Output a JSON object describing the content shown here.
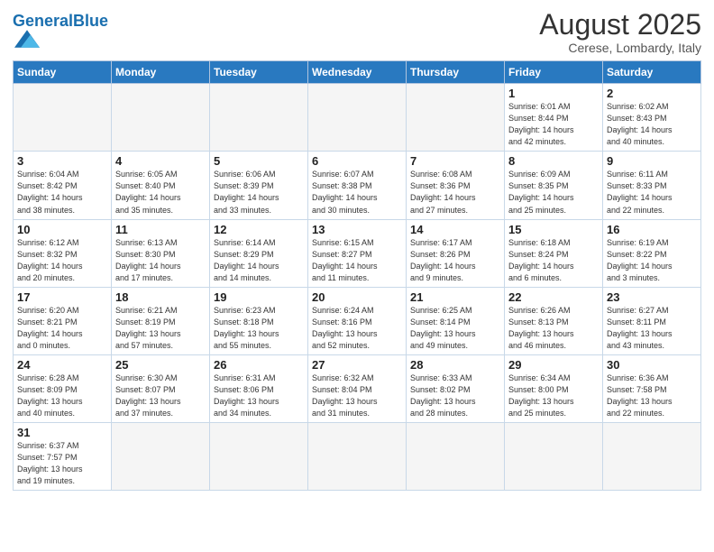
{
  "header": {
    "logo_general": "General",
    "logo_blue": "Blue",
    "month_year": "August 2025",
    "location": "Cerese, Lombardy, Italy"
  },
  "weekdays": [
    "Sunday",
    "Monday",
    "Tuesday",
    "Wednesday",
    "Thursday",
    "Friday",
    "Saturday"
  ],
  "weeks": [
    [
      {
        "day": "",
        "info": ""
      },
      {
        "day": "",
        "info": ""
      },
      {
        "day": "",
        "info": ""
      },
      {
        "day": "",
        "info": ""
      },
      {
        "day": "",
        "info": ""
      },
      {
        "day": "1",
        "info": "Sunrise: 6:01 AM\nSunset: 8:44 PM\nDaylight: 14 hours\nand 42 minutes."
      },
      {
        "day": "2",
        "info": "Sunrise: 6:02 AM\nSunset: 8:43 PM\nDaylight: 14 hours\nand 40 minutes."
      }
    ],
    [
      {
        "day": "3",
        "info": "Sunrise: 6:04 AM\nSunset: 8:42 PM\nDaylight: 14 hours\nand 38 minutes."
      },
      {
        "day": "4",
        "info": "Sunrise: 6:05 AM\nSunset: 8:40 PM\nDaylight: 14 hours\nand 35 minutes."
      },
      {
        "day": "5",
        "info": "Sunrise: 6:06 AM\nSunset: 8:39 PM\nDaylight: 14 hours\nand 33 minutes."
      },
      {
        "day": "6",
        "info": "Sunrise: 6:07 AM\nSunset: 8:38 PM\nDaylight: 14 hours\nand 30 minutes."
      },
      {
        "day": "7",
        "info": "Sunrise: 6:08 AM\nSunset: 8:36 PM\nDaylight: 14 hours\nand 27 minutes."
      },
      {
        "day": "8",
        "info": "Sunrise: 6:09 AM\nSunset: 8:35 PM\nDaylight: 14 hours\nand 25 minutes."
      },
      {
        "day": "9",
        "info": "Sunrise: 6:11 AM\nSunset: 8:33 PM\nDaylight: 14 hours\nand 22 minutes."
      }
    ],
    [
      {
        "day": "10",
        "info": "Sunrise: 6:12 AM\nSunset: 8:32 PM\nDaylight: 14 hours\nand 20 minutes."
      },
      {
        "day": "11",
        "info": "Sunrise: 6:13 AM\nSunset: 8:30 PM\nDaylight: 14 hours\nand 17 minutes."
      },
      {
        "day": "12",
        "info": "Sunrise: 6:14 AM\nSunset: 8:29 PM\nDaylight: 14 hours\nand 14 minutes."
      },
      {
        "day": "13",
        "info": "Sunrise: 6:15 AM\nSunset: 8:27 PM\nDaylight: 14 hours\nand 11 minutes."
      },
      {
        "day": "14",
        "info": "Sunrise: 6:17 AM\nSunset: 8:26 PM\nDaylight: 14 hours\nand 9 minutes."
      },
      {
        "day": "15",
        "info": "Sunrise: 6:18 AM\nSunset: 8:24 PM\nDaylight: 14 hours\nand 6 minutes."
      },
      {
        "day": "16",
        "info": "Sunrise: 6:19 AM\nSunset: 8:22 PM\nDaylight: 14 hours\nand 3 minutes."
      }
    ],
    [
      {
        "day": "17",
        "info": "Sunrise: 6:20 AM\nSunset: 8:21 PM\nDaylight: 14 hours\nand 0 minutes."
      },
      {
        "day": "18",
        "info": "Sunrise: 6:21 AM\nSunset: 8:19 PM\nDaylight: 13 hours\nand 57 minutes."
      },
      {
        "day": "19",
        "info": "Sunrise: 6:23 AM\nSunset: 8:18 PM\nDaylight: 13 hours\nand 55 minutes."
      },
      {
        "day": "20",
        "info": "Sunrise: 6:24 AM\nSunset: 8:16 PM\nDaylight: 13 hours\nand 52 minutes."
      },
      {
        "day": "21",
        "info": "Sunrise: 6:25 AM\nSunset: 8:14 PM\nDaylight: 13 hours\nand 49 minutes."
      },
      {
        "day": "22",
        "info": "Sunrise: 6:26 AM\nSunset: 8:13 PM\nDaylight: 13 hours\nand 46 minutes."
      },
      {
        "day": "23",
        "info": "Sunrise: 6:27 AM\nSunset: 8:11 PM\nDaylight: 13 hours\nand 43 minutes."
      }
    ],
    [
      {
        "day": "24",
        "info": "Sunrise: 6:28 AM\nSunset: 8:09 PM\nDaylight: 13 hours\nand 40 minutes."
      },
      {
        "day": "25",
        "info": "Sunrise: 6:30 AM\nSunset: 8:07 PM\nDaylight: 13 hours\nand 37 minutes."
      },
      {
        "day": "26",
        "info": "Sunrise: 6:31 AM\nSunset: 8:06 PM\nDaylight: 13 hours\nand 34 minutes."
      },
      {
        "day": "27",
        "info": "Sunrise: 6:32 AM\nSunset: 8:04 PM\nDaylight: 13 hours\nand 31 minutes."
      },
      {
        "day": "28",
        "info": "Sunrise: 6:33 AM\nSunset: 8:02 PM\nDaylight: 13 hours\nand 28 minutes."
      },
      {
        "day": "29",
        "info": "Sunrise: 6:34 AM\nSunset: 8:00 PM\nDaylight: 13 hours\nand 25 minutes."
      },
      {
        "day": "30",
        "info": "Sunrise: 6:36 AM\nSunset: 7:58 PM\nDaylight: 13 hours\nand 22 minutes."
      }
    ],
    [
      {
        "day": "31",
        "info": "Sunrise: 6:37 AM\nSunset: 7:57 PM\nDaylight: 13 hours\nand 19 minutes."
      },
      {
        "day": "",
        "info": ""
      },
      {
        "day": "",
        "info": ""
      },
      {
        "day": "",
        "info": ""
      },
      {
        "day": "",
        "info": ""
      },
      {
        "day": "",
        "info": ""
      },
      {
        "day": "",
        "info": ""
      }
    ]
  ]
}
